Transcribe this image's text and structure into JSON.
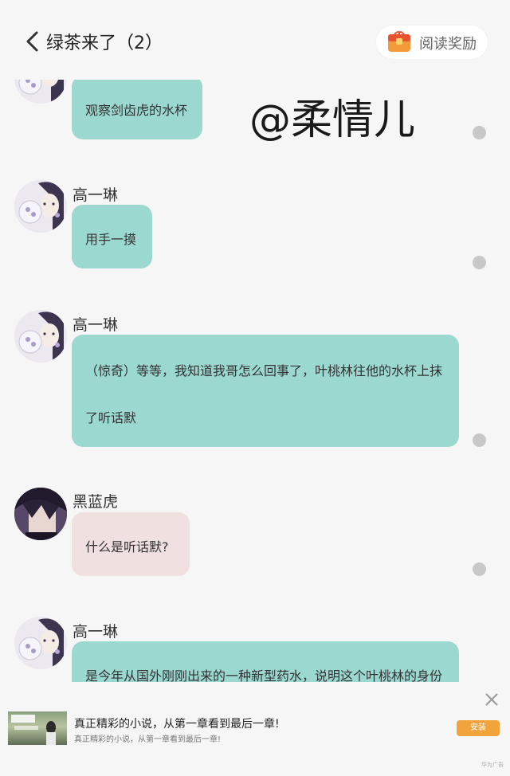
{
  "header": {
    "title": "绿茶来了（2）",
    "reward_label": "阅读奖励"
  },
  "watermark": "@柔情儿",
  "messages": [
    {
      "sender": "",
      "lines": [
        "观察剑齿虎的水杯"
      ]
    },
    {
      "sender": "高一琳",
      "lines": [
        "用手一摸"
      ]
    },
    {
      "sender": "高一琳",
      "lines": [
        "（惊奇）等等，我知道我哥怎么回事了，叶桃林往他的水杯上抹",
        "了听话默"
      ]
    },
    {
      "sender": "黑蓝虎",
      "lines": [
        "什么是听话默?"
      ]
    },
    {
      "sender": "高一琳",
      "lines": [
        "是今年从国外刚刚出来的一种新型药水，说明这个叶桃林的身份"
      ]
    }
  ],
  "ad": {
    "title": "真正精彩的小说，从第一章看到最后一章!",
    "subtitle": "真正精彩的小说，从第一章看到最后一章!",
    "install_label": "安装",
    "source_label": "华为广告"
  },
  "colors": {
    "background": "#f6f6f6",
    "bubble_teal": "#9bd8d0",
    "bubble_pink": "#f0e0df",
    "install": "#f2a33b"
  }
}
